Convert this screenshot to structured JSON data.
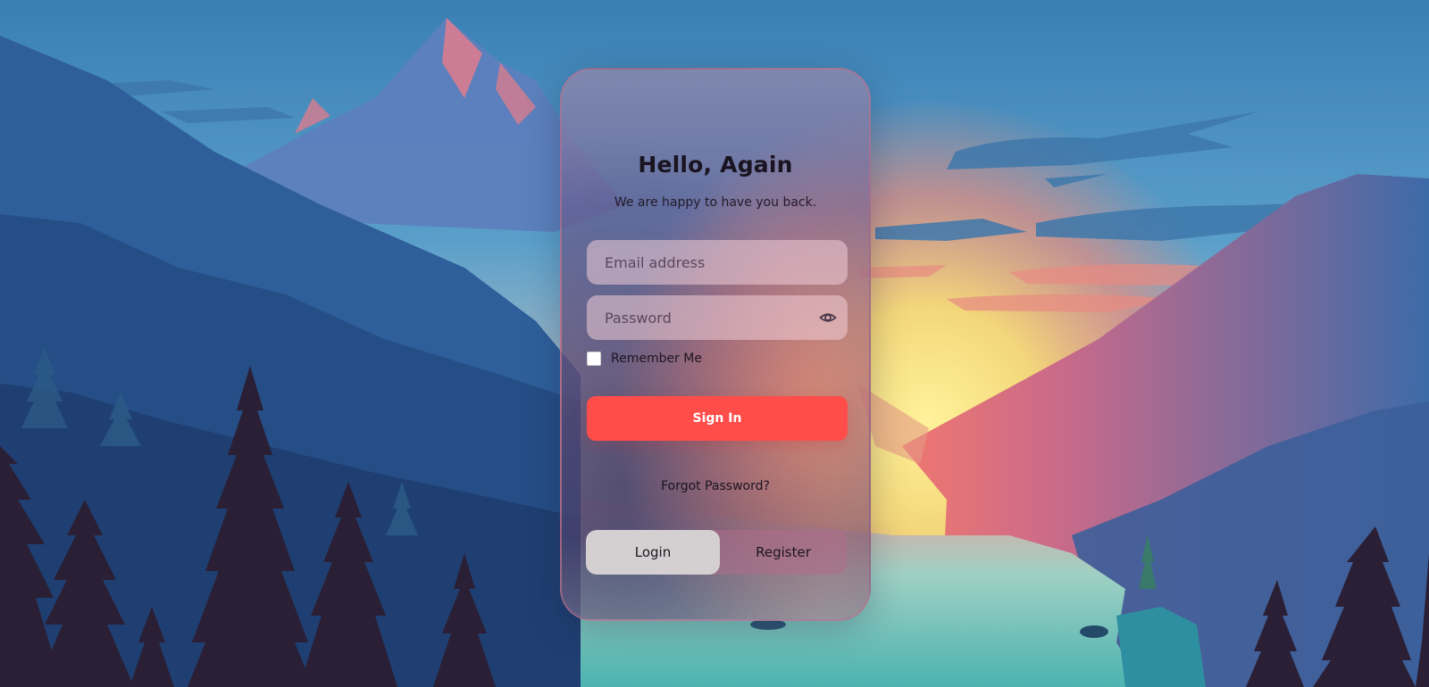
{
  "colors": {
    "accent": "#ff4d4a",
    "sky_top": "#3a7fb4",
    "sunset_yellow": "#f3dd7c",
    "sunset_pink": "#e9767a",
    "mountain_blue": "#2a5a92",
    "tree_dark": "#241a30"
  },
  "login_card": {
    "title": "Hello, Again",
    "subtitle": "We are happy to have you back.",
    "email_placeholder": "Email address",
    "password_placeholder": "Password",
    "password_toggle_icon": "eye-icon",
    "remember_label": "Remember Me",
    "remember_checked": false,
    "sign_in_label": "Sign In",
    "forgot_label": "Forgot Password?",
    "tabs": [
      {
        "label": "Login",
        "active": true
      },
      {
        "label": "Register",
        "active": false
      }
    ]
  }
}
